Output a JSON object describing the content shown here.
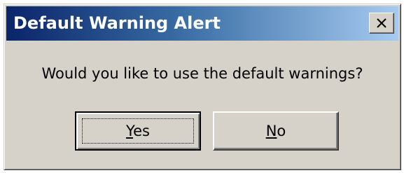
{
  "window": {
    "title": "Default Warning Alert",
    "close_icon": "close-x-icon"
  },
  "message": "Would you like to use the default warnings?",
  "buttons": {
    "yes": {
      "mnemonic": "Y",
      "rest": "es"
    },
    "no": {
      "mnemonic": "N",
      "rest": "o"
    }
  },
  "colors": {
    "titlebar_start": "#0a246a",
    "titlebar_end": "#a6caf0",
    "face": "#d6d2c9"
  }
}
